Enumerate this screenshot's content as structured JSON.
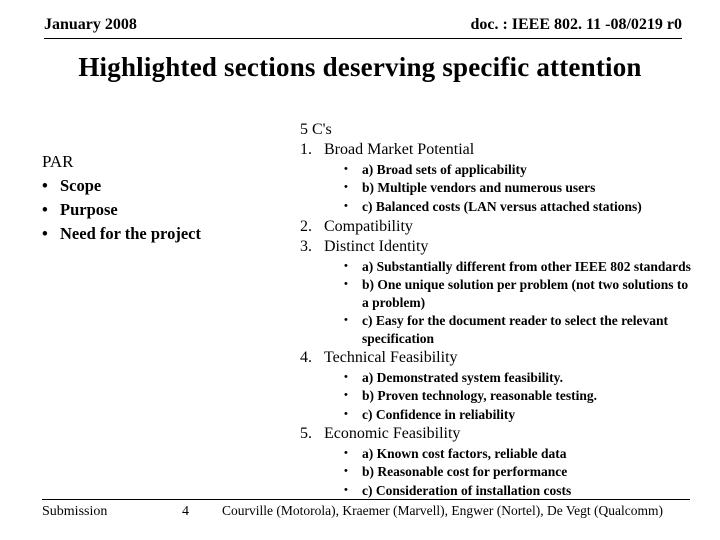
{
  "header": {
    "date": "January 2008",
    "docnum": "doc. : IEEE 802. 11 -08/0219 r0"
  },
  "title": "Highlighted sections deserving specific attention",
  "left": {
    "par_title": "PAR",
    "items": [
      "Scope",
      "Purpose",
      "Need for the project"
    ]
  },
  "right": {
    "fivec_title": "5 C's",
    "items": [
      {
        "num": "1.",
        "label": "Broad Market Potential",
        "subs": [
          "a) Broad sets of applicability",
          "b) Multiple vendors and numerous users",
          "c) Balanced costs (LAN versus attached stations)"
        ]
      },
      {
        "num": "2.",
        "label": "Compatibility",
        "subs": []
      },
      {
        "num": "3.",
        "label": "Distinct Identity",
        "subs": [
          "a) Substantially different from other IEEE 802 standards",
          "b) One unique solution per problem (not two solutions to a problem)",
          "c) Easy for the document reader to select the relevant specification"
        ]
      },
      {
        "num": "4.",
        "label": "Technical Feasibility",
        "subs": [
          "a) Demonstrated system feasibility.",
          "b) Proven technology, reasonable testing.",
          "c) Confidence in reliability"
        ]
      },
      {
        "num": "5.",
        "label": "Economic Feasibility",
        "subs": [
          "a) Known cost factors, reliable data",
          "b) Reasonable cost for performance",
          "c) Consideration of installation costs"
        ]
      }
    ]
  },
  "footer": {
    "submission": "Submission",
    "page": "4",
    "authors": "Courville (Motorola), Kraemer (Marvell), Engwer (Nortel), De Vegt (Qualcomm)"
  }
}
